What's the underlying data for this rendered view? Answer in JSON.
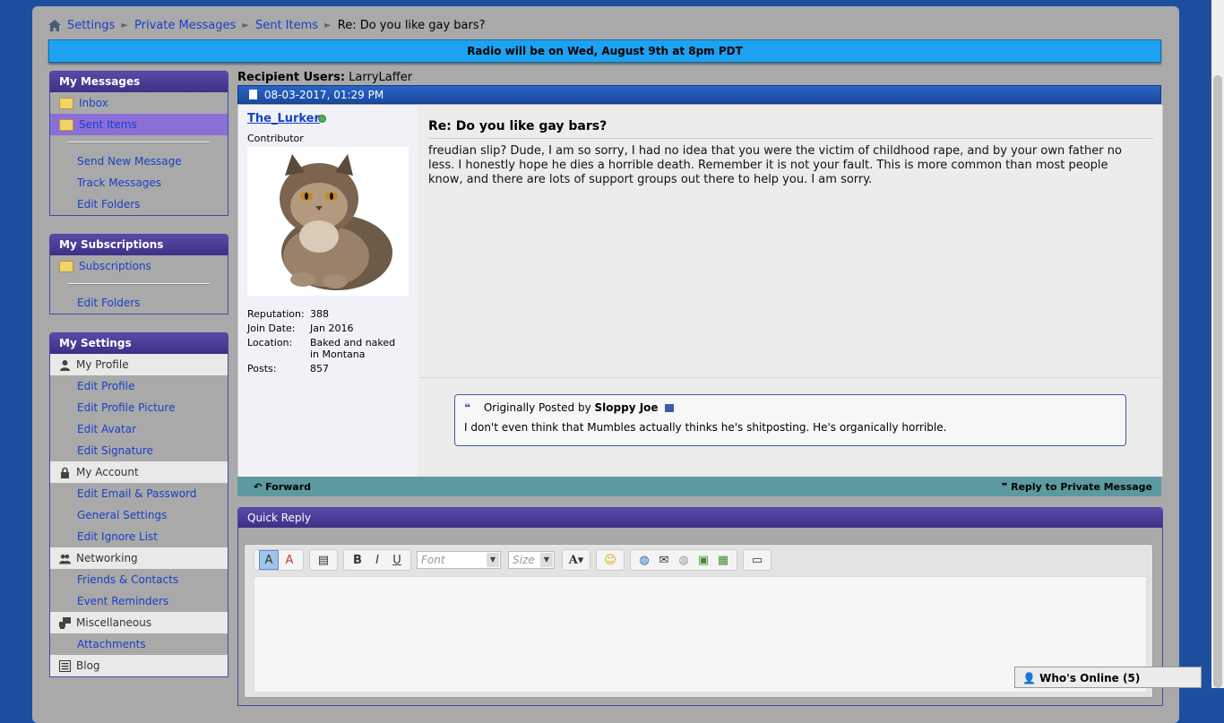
{
  "breadcrumb": {
    "items": [
      "Settings",
      "Private Messages",
      "Sent Items"
    ],
    "current": "Re: Do you like gay bars?"
  },
  "banner": {
    "text": "Radio will be on Wed, August 9th at 8pm PDT"
  },
  "sidebar": {
    "messages": {
      "title": "My Messages",
      "folders": [
        "Inbox",
        "Sent Items"
      ],
      "links": [
        "Send New Message",
        "Track Messages",
        "Edit Folders"
      ]
    },
    "subscriptions": {
      "title": "My Subscriptions",
      "folders": [
        "Subscriptions"
      ],
      "links": [
        "Edit Folders"
      ]
    },
    "settings": {
      "title": "My Settings",
      "profile": {
        "label": "My Profile",
        "links": [
          "Edit Profile",
          "Edit Profile Picture",
          "Edit Avatar",
          "Edit Signature"
        ]
      },
      "account": {
        "label": "My Account",
        "links": [
          "Edit Email & Password",
          "General Settings",
          "Edit Ignore List"
        ]
      },
      "networking": {
        "label": "Networking",
        "links": [
          "Friends & Contacts",
          "Event Reminders"
        ]
      },
      "misc": {
        "label": "Miscellaneous",
        "links": [
          "Attachments"
        ]
      },
      "blog": {
        "label": "Blog"
      }
    }
  },
  "message": {
    "recipients_label": "Recipient Users:",
    "recipients": "LarryLaffer",
    "date": "08-03-2017, 01:29 PM",
    "author": "The_Lurker",
    "author_title": "Contributor",
    "stats": [
      {
        "k": "Reputation:",
        "v": "388"
      },
      {
        "k": "Join Date:",
        "v": "Jan 2016"
      },
      {
        "k": "Location:",
        "v": "Baked and naked in Montana"
      },
      {
        "k": "Posts:",
        "v": "857"
      }
    ],
    "title": "Re: Do you like gay bars?",
    "body": "freudian slip? Dude, I am so sorry, I had no idea that you were the victim of childhood rape, and by your own father no less. I honestly hope he dies a horrible death. Remember it is not your fault. This is more common than most people know, and there are lots of support groups out there to help you. I am sorry.",
    "quote": {
      "prefix": "Originally Posted by",
      "author": "Sloppy Joe",
      "text": "I don't even think that Mumbles actually thinks he's shitposting. He's organically horrible."
    },
    "forward": "Forward",
    "reply": "Reply to Private Message"
  },
  "quick_reply": {
    "title": "Quick Reply",
    "font_placeholder": "Font",
    "size_placeholder": "Size"
  },
  "whos_online": "Who's Online (5)"
}
